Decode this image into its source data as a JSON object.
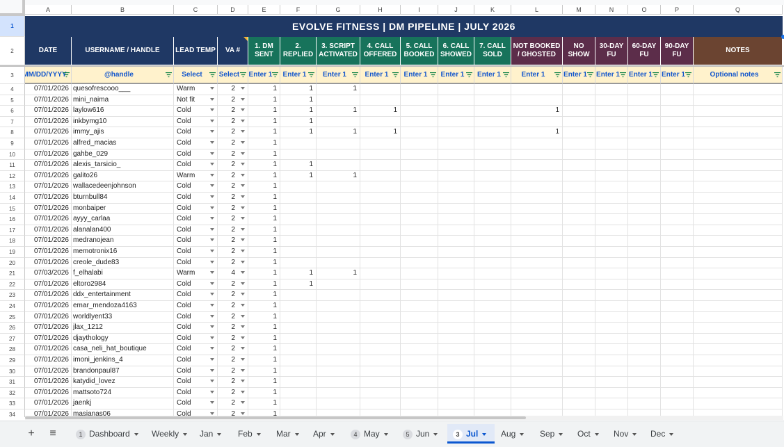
{
  "sheet": {
    "title": "EVOLVE FITNESS  |  DM PIPELINE  |  JULY 2026",
    "col_letters": [
      "A",
      "B",
      "C",
      "D",
      "E",
      "F",
      "G",
      "H",
      "I",
      "J",
      "K",
      "L",
      "M",
      "N",
      "O",
      "P",
      "Q"
    ],
    "row_numbers": [
      "1",
      "2",
      "3",
      "4",
      "5",
      "6",
      "7",
      "8",
      "9",
      "10",
      "11",
      "12",
      "13",
      "14",
      "15",
      "16",
      "17",
      "18",
      "19",
      "20",
      "21",
      "22",
      "23",
      "24",
      "25",
      "26",
      "27",
      "28",
      "29",
      "30",
      "31",
      "32",
      "33",
      "34"
    ],
    "headers": [
      "DATE",
      "USERNAME / HANDLE",
      "LEAD TEMP",
      "VA #",
      "1. DM SENT",
      "2. REPLIED",
      "3. SCRIPT ACTIVATED",
      "4. CALL OFFERED",
      "5. CALL BOOKED",
      "6. CALL SHOWED",
      "7. CALL SOLD",
      "NOT BOOKED / GHOSTED",
      "NO SHOW",
      "30-DAY FU",
      "60-DAY FU",
      "90-DAY FU",
      "NOTES"
    ],
    "subheaders": [
      "MM/DD/YYYY",
      "@handle",
      "Select",
      "Select",
      "Enter 1",
      "Enter 1",
      "Enter 1",
      "Enter 1",
      "Enter 1",
      "Enter 1",
      "Enter 1",
      "Enter 1",
      "Enter 1",
      "Enter 1",
      "Enter 1",
      "Enter 1",
      "Optional notes"
    ],
    "rows": [
      {
        "date": "07/01/2026",
        "handle": "quesofrescooo___",
        "temp": "Warm",
        "va": "2",
        "m": [
          "1",
          "1",
          "1",
          "",
          "",
          "",
          "",
          "",
          "",
          "",
          "",
          ""
        ]
      },
      {
        "date": "07/01/2026",
        "handle": "mini_naima",
        "temp": "Not fit",
        "va": "2",
        "m": [
          "1",
          "1",
          "",
          "",
          "",
          "",
          "",
          "",
          "",
          "",
          "",
          ""
        ]
      },
      {
        "date": "07/01/2026",
        "handle": "laylow616",
        "temp": "Cold",
        "va": "2",
        "m": [
          "1",
          "1",
          "1",
          "1",
          "",
          "",
          "",
          "1",
          "",
          "",
          "",
          ""
        ]
      },
      {
        "date": "07/01/2026",
        "handle": "inkbymg10",
        "temp": "Cold",
        "va": "2",
        "m": [
          "1",
          "1",
          "",
          "",
          "",
          "",
          "",
          "",
          "",
          "",
          "",
          ""
        ]
      },
      {
        "date": "07/01/2026",
        "handle": "immy_ajis",
        "temp": "Cold",
        "va": "2",
        "m": [
          "1",
          "1",
          "1",
          "1",
          "",
          "",
          "",
          "1",
          "",
          "",
          "",
          ""
        ]
      },
      {
        "date": "07/01/2026",
        "handle": "alfred_macias",
        "temp": "Cold",
        "va": "2",
        "m": [
          "1",
          "",
          "",
          "",
          "",
          "",
          "",
          "",
          "",
          "",
          "",
          ""
        ]
      },
      {
        "date": "07/01/2026",
        "handle": "gahbe_029",
        "temp": "Cold",
        "va": "2",
        "m": [
          "1",
          "",
          "",
          "",
          "",
          "",
          "",
          "",
          "",
          "",
          "",
          ""
        ]
      },
      {
        "date": "07/01/2026",
        "handle": "alexis_tarsicio_",
        "temp": "Cold",
        "va": "2",
        "m": [
          "1",
          "1",
          "",
          "",
          "",
          "",
          "",
          "",
          "",
          "",
          "",
          ""
        ]
      },
      {
        "date": "07/01/2026",
        "handle": "galito26",
        "temp": "Warm",
        "va": "2",
        "m": [
          "1",
          "1",
          "1",
          "",
          "",
          "",
          "",
          "",
          "",
          "",
          "",
          ""
        ]
      },
      {
        "date": "07/01/2026",
        "handle": "wallacedeenjohnson",
        "temp": "Cold",
        "va": "2",
        "m": [
          "1",
          "",
          "",
          "",
          "",
          "",
          "",
          "",
          "",
          "",
          "",
          ""
        ]
      },
      {
        "date": "07/01/2026",
        "handle": "bturnbull84",
        "temp": "Cold",
        "va": "2",
        "m": [
          "1",
          "",
          "",
          "",
          "",
          "",
          "",
          "",
          "",
          "",
          "",
          ""
        ]
      },
      {
        "date": "07/01/2026",
        "handle": "monbaiper",
        "temp": "Cold",
        "va": "2",
        "m": [
          "1",
          "",
          "",
          "",
          "",
          "",
          "",
          "",
          "",
          "",
          "",
          ""
        ]
      },
      {
        "date": "07/01/2026",
        "handle": "ayyy_carlaa",
        "temp": "Cold",
        "va": "2",
        "m": [
          "1",
          "",
          "",
          "",
          "",
          "",
          "",
          "",
          "",
          "",
          "",
          ""
        ]
      },
      {
        "date": "07/01/2026",
        "handle": "alanalan400",
        "temp": "Cold",
        "va": "2",
        "m": [
          "1",
          "",
          "",
          "",
          "",
          "",
          "",
          "",
          "",
          "",
          "",
          ""
        ]
      },
      {
        "date": "07/01/2026",
        "handle": "medranojean",
        "temp": "Cold",
        "va": "2",
        "m": [
          "1",
          "",
          "",
          "",
          "",
          "",
          "",
          "",
          "",
          "",
          "",
          ""
        ]
      },
      {
        "date": "07/01/2026",
        "handle": "memotronix16",
        "temp": "Cold",
        "va": "2",
        "m": [
          "1",
          "",
          "",
          "",
          "",
          "",
          "",
          "",
          "",
          "",
          "",
          ""
        ]
      },
      {
        "date": "07/01/2026",
        "handle": "creole_dude83",
        "temp": "Cold",
        "va": "2",
        "m": [
          "1",
          "",
          "",
          "",
          "",
          "",
          "",
          "",
          "",
          "",
          "",
          ""
        ]
      },
      {
        "date": "07/03/2026",
        "handle": "f_elhalabi",
        "temp": "Warm",
        "va": "4",
        "m": [
          "1",
          "1",
          "1",
          "",
          "",
          "",
          "",
          "",
          "",
          "",
          "",
          ""
        ]
      },
      {
        "date": "07/01/2026",
        "handle": "eltoro2984",
        "temp": "Cold",
        "va": "2",
        "m": [
          "1",
          "1",
          "",
          "",
          "",
          "",
          "",
          "",
          "",
          "",
          "",
          ""
        ]
      },
      {
        "date": "07/01/2026",
        "handle": "ddx_entertainment",
        "temp": "Cold",
        "va": "2",
        "m": [
          "1",
          "",
          "",
          "",
          "",
          "",
          "",
          "",
          "",
          "",
          "",
          ""
        ]
      },
      {
        "date": "07/01/2026",
        "handle": "emar_mendoza4163",
        "temp": "Cold",
        "va": "2",
        "m": [
          "1",
          "",
          "",
          "",
          "",
          "",
          "",
          "",
          "",
          "",
          "",
          ""
        ]
      },
      {
        "date": "07/01/2026",
        "handle": "worldlyent33",
        "temp": "Cold",
        "va": "2",
        "m": [
          "1",
          "",
          "",
          "",
          "",
          "",
          "",
          "",
          "",
          "",
          "",
          ""
        ]
      },
      {
        "date": "07/01/2026",
        "handle": "jlax_1212",
        "temp": "Cold",
        "va": "2",
        "m": [
          "1",
          "",
          "",
          "",
          "",
          "",
          "",
          "",
          "",
          "",
          "",
          ""
        ]
      },
      {
        "date": "07/01/2026",
        "handle": "djaythology",
        "temp": "Cold",
        "va": "2",
        "m": [
          "1",
          "",
          "",
          "",
          "",
          "",
          "",
          "",
          "",
          "",
          "",
          ""
        ]
      },
      {
        "date": "07/01/2026",
        "handle": "casa_neli_hat_boutique",
        "temp": "Cold",
        "va": "2",
        "m": [
          "1",
          "",
          "",
          "",
          "",
          "",
          "",
          "",
          "",
          "",
          "",
          ""
        ]
      },
      {
        "date": "07/01/2026",
        "handle": "imoni_jenkins_4",
        "temp": "Cold",
        "va": "2",
        "m": [
          "1",
          "",
          "",
          "",
          "",
          "",
          "",
          "",
          "",
          "",
          "",
          ""
        ]
      },
      {
        "date": "07/01/2026",
        "handle": "brandonpaul87",
        "temp": "Cold",
        "va": "2",
        "m": [
          "1",
          "",
          "",
          "",
          "",
          "",
          "",
          "",
          "",
          "",
          "",
          ""
        ]
      },
      {
        "date": "07/01/2026",
        "handle": "katydid_lovez",
        "temp": "Cold",
        "va": "2",
        "m": [
          "1",
          "",
          "",
          "",
          "",
          "",
          "",
          "",
          "",
          "",
          "",
          ""
        ]
      },
      {
        "date": "07/01/2026",
        "handle": "mattsoto724",
        "temp": "Cold",
        "va": "2",
        "m": [
          "1",
          "",
          "",
          "",
          "",
          "",
          "",
          "",
          "",
          "",
          "",
          ""
        ]
      },
      {
        "date": "07/01/2026",
        "handle": "jaenkj",
        "temp": "Cold",
        "va": "2",
        "m": [
          "1",
          "",
          "",
          "",
          "",
          "",
          "",
          "",
          "",
          "",
          "",
          ""
        ]
      },
      {
        "date": "07/01/2026",
        "handle": "masianas06",
        "temp": "Cold",
        "va": "2",
        "m": [
          "1",
          "",
          "",
          "",
          "",
          "",
          "",
          "",
          "",
          "",
          "",
          ""
        ]
      }
    ]
  },
  "tabs": [
    {
      "label": "Dashboard",
      "badge": "1",
      "active": false
    },
    {
      "label": "Weekly",
      "badge": "",
      "active": false
    },
    {
      "label": "Jan",
      "badge": "",
      "active": false
    },
    {
      "label": "Feb",
      "badge": "",
      "active": false
    },
    {
      "label": "Mar",
      "badge": "",
      "active": false
    },
    {
      "label": "Apr",
      "badge": "",
      "active": false
    },
    {
      "label": "May",
      "badge": "4",
      "active": false
    },
    {
      "label": "Jun",
      "badge": "5",
      "active": false
    },
    {
      "label": "Jul",
      "badge": "3",
      "active": true
    },
    {
      "label": "Aug",
      "badge": "",
      "active": false
    },
    {
      "label": "Sep",
      "badge": "",
      "active": false
    },
    {
      "label": "Oct",
      "badge": "",
      "active": false
    },
    {
      "label": "Nov",
      "badge": "",
      "active": false
    },
    {
      "label": "Dec",
      "badge": "",
      "active": false
    }
  ],
  "toolbar": {
    "add_sheet": "+",
    "all_sheets": "≡"
  },
  "colors": {
    "title": "#1f3864",
    "navy": "#1f3864",
    "green": "#17735b",
    "plum": "#5c2d4a",
    "brown": "#6b4431",
    "subheader": "#fff2cc",
    "accent": "#0b57d0"
  }
}
